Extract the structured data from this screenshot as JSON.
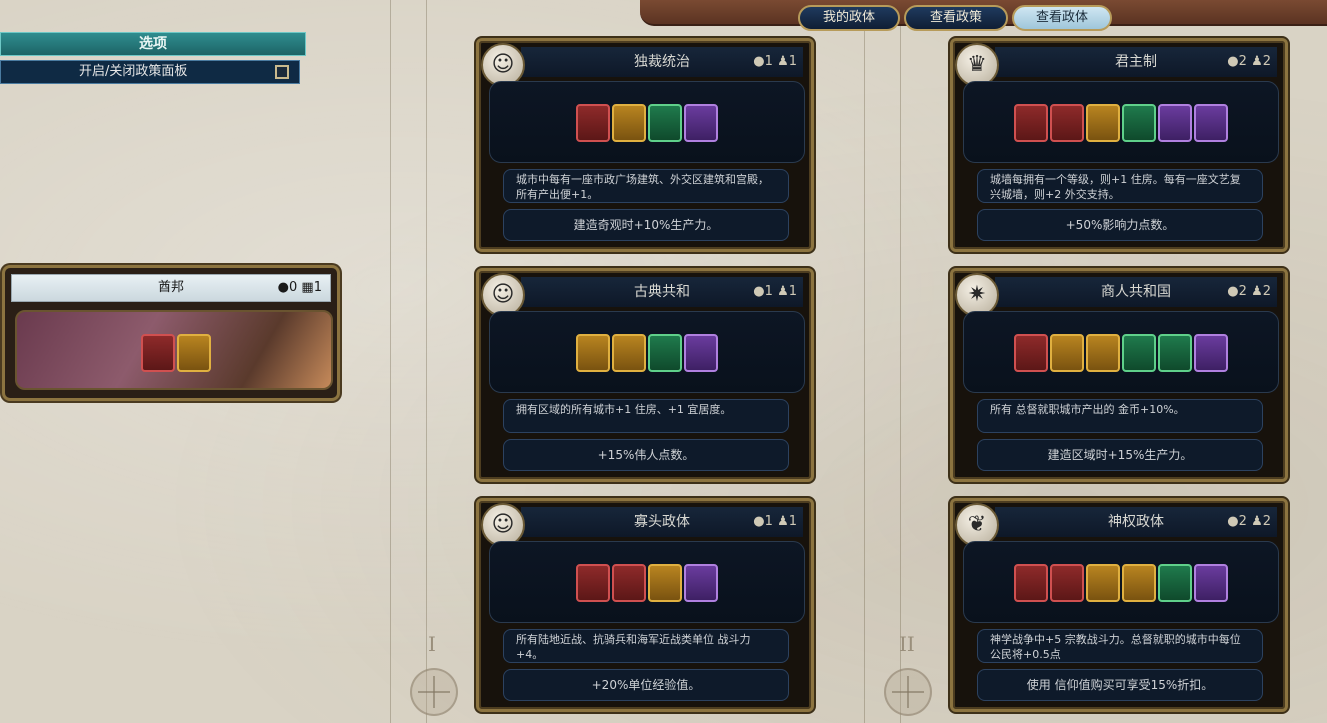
{
  "tabs": [
    {
      "label": "我的政体",
      "active": false
    },
    {
      "label": "查看政策",
      "active": false
    },
    {
      "label": "查看政体",
      "active": true
    }
  ],
  "options": {
    "title": "选项",
    "toggle_label": "开启/关闭政策面板"
  },
  "current_government": {
    "name": "酋邦",
    "stats": "0",
    "stats2": "1",
    "slots": [
      "military",
      "economic"
    ]
  },
  "column_numerals": [
    "I",
    "II"
  ],
  "governments": [
    {
      "name": "独裁统治",
      "stat_a": "1",
      "stat_b": "1",
      "icon": "bust-icon",
      "slots": [
        "military",
        "economic",
        "diplomatic",
        "wildcard"
      ],
      "description": "城市中每有一座市政广场建筑、外交区建筑和宫殿，所有产出便+1。",
      "bonus": "建造奇观时+10%生产力。"
    },
    {
      "name": "君主制",
      "stat_a": "2",
      "stat_b": "2",
      "icon": "crown-icon",
      "slots": [
        "military",
        "military",
        "economic",
        "diplomatic",
        "wildcard",
        "wildcard"
      ],
      "description": "城墙每拥有一个等级，则+1 住房。每有一座文艺复兴城墙，则+2 外交支持。",
      "bonus": "+50%影响力点数。"
    },
    {
      "name": "古典共和",
      "stat_a": "1",
      "stat_b": "1",
      "icon": "bust-icon",
      "slots": [
        "economic",
        "economic",
        "diplomatic",
        "wildcard"
      ],
      "description": "拥有区域的所有城市+1 住房、+1 宜居度。",
      "bonus": "+15%伟人点数。"
    },
    {
      "name": "商人共和国",
      "stat_a": "2",
      "stat_b": "2",
      "icon": "compass-icon",
      "slots": [
        "military",
        "economic",
        "economic",
        "diplomatic",
        "diplomatic",
        "wildcard"
      ],
      "description": "所有 总督就职城市产出的 金币+10%。",
      "bonus": "建造区域时+15%生产力。"
    },
    {
      "name": "寡头政体",
      "stat_a": "1",
      "stat_b": "1",
      "icon": "bust-icon",
      "slots": [
        "military",
        "military",
        "economic",
        "wildcard"
      ],
      "description": "所有陆地近战、抗骑兵和海军近战类单位 战斗力+4。",
      "bonus": "+20%单位经验值。"
    },
    {
      "name": "神权政体",
      "stat_a": "2",
      "stat_b": "2",
      "icon": "wings-icon",
      "slots": [
        "military",
        "military",
        "economic",
        "economic",
        "diplomatic",
        "wildcard"
      ],
      "description": "神学战争中+5 宗教战斗力。总督就职的城市中每位 公民将+0.5点",
      "bonus": "使用 信仰值购买可享受15%折扣。"
    }
  ]
}
